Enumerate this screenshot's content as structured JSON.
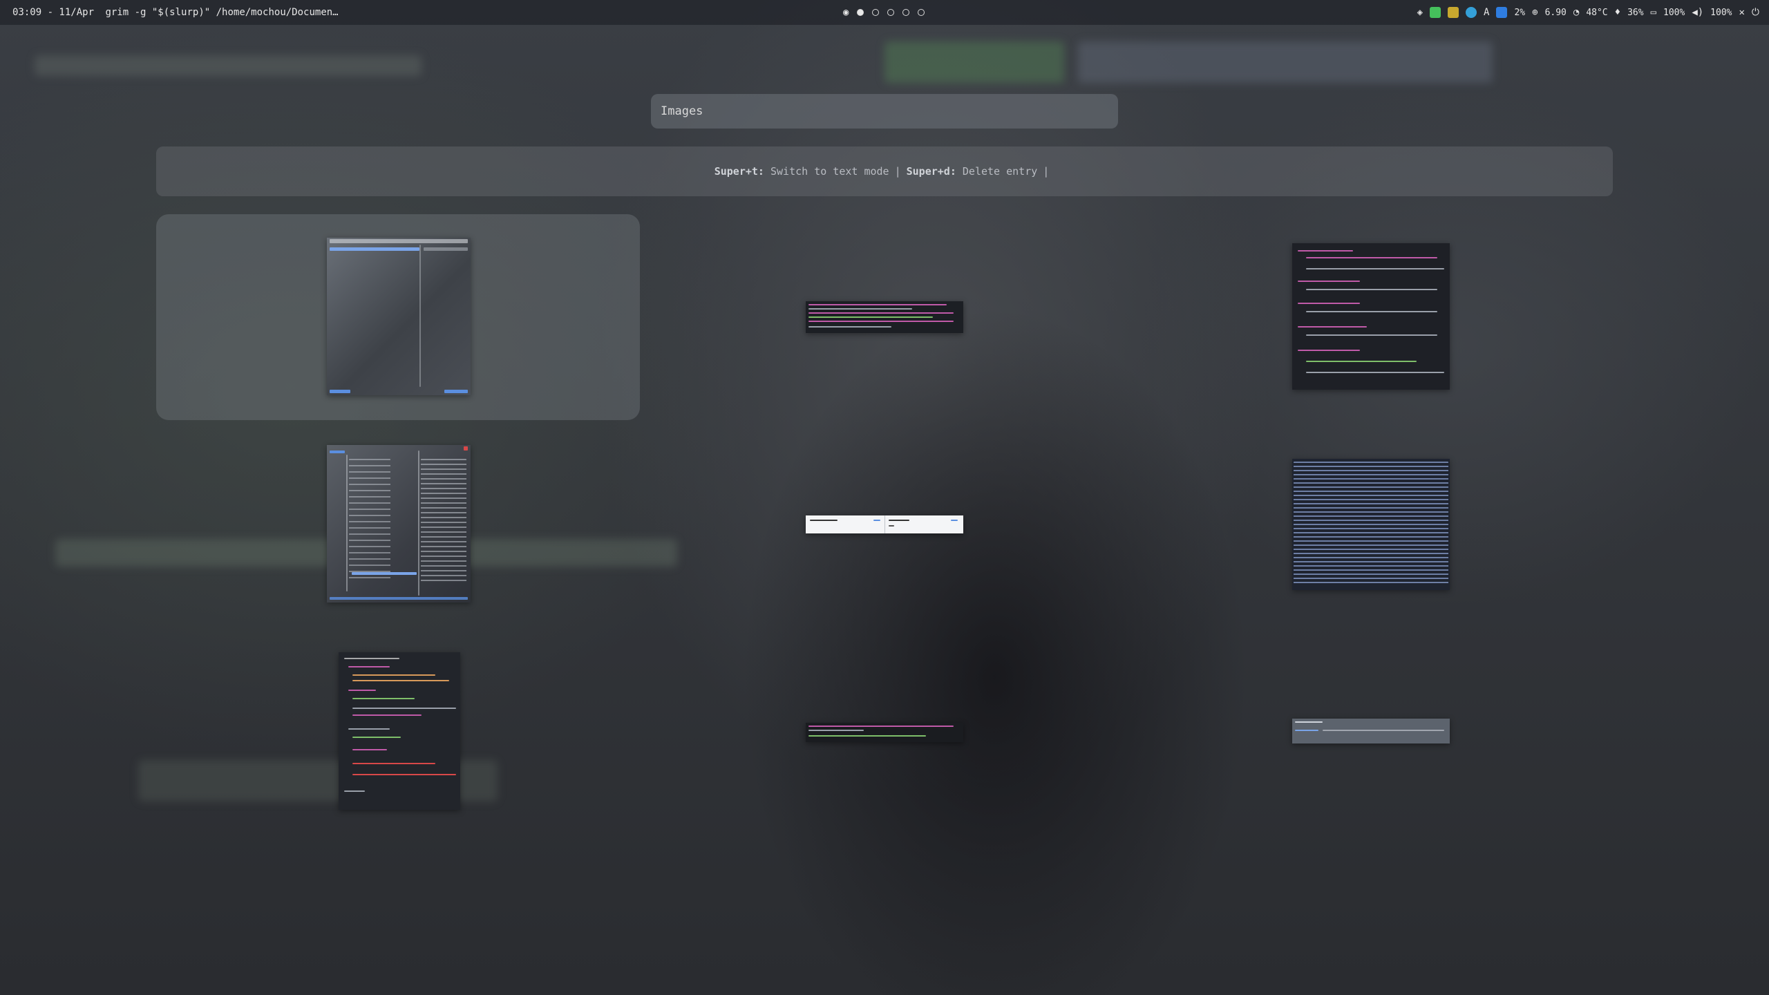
{
  "topbar": {
    "clock": "03:09 - 11/Apr",
    "window_title": "grim -g \"$(slurp)\" /home/mochou/Documen…",
    "workspaces": [
      true,
      true,
      false,
      false,
      false
    ],
    "status": {
      "cpu": "2%",
      "load": "6.90",
      "temp": "48°C",
      "memory": "36%",
      "battery": "100%",
      "volume": "100%"
    }
  },
  "launcher": {
    "query": "Images",
    "hints": {
      "key1": "Super+t:",
      "action1": "Switch to text mode",
      "key2": "Super+d:",
      "action2": "Delete entry",
      "trailing": "|"
    }
  },
  "entries": [
    {
      "kind": "terminal-file-manager-screenshot",
      "selected": true
    },
    {
      "kind": "terminal-log-screenshot",
      "selected": false
    },
    {
      "kind": "code-editor-screenshot",
      "selected": false
    },
    {
      "kind": "file-tree-screenshot",
      "selected": false
    },
    {
      "kind": "chat-window-screenshot",
      "selected": false
    },
    {
      "kind": "hash-list-screenshot",
      "selected": false
    },
    {
      "kind": "nix-config-screenshot",
      "selected": false
    },
    {
      "kind": "terminal-prompt-screenshot",
      "selected": false
    },
    {
      "kind": "file-path-screenshot",
      "selected": false
    }
  ],
  "colors": {
    "accent": "#5b8fe0",
    "panel": "#1e2127",
    "code_pink": "#c05aa8",
    "code_green": "#7fbf6a"
  }
}
